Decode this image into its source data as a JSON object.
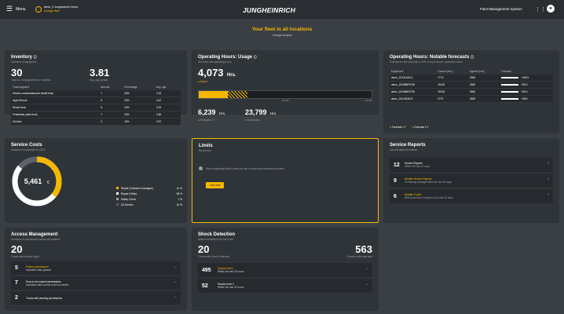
{
  "topbar": {
    "menu_label": "Menu",
    "location_name": "demo_3 Jungheinrich Demo",
    "location_sub": "Change fleet",
    "brand": "JUNGHEINRICH",
    "system_name": "Fleet Management System"
  },
  "hero": {
    "title": "Your fleet in all locations",
    "subtitle": "Change location"
  },
  "inventory": {
    "title": "Inventory",
    "subtitle": "Overview of equipment",
    "count": "30",
    "count_label": "Total no. of equipment in 1 locations",
    "avg_age": "3.81",
    "avg_age_label": "Avg. age (years)",
    "columns": [
      "Truck segment",
      "Amount",
      "Percentage",
      "Avg. age"
    ],
    "rows": [
      [
        "Electric counterbalanced forklift truck",
        "7",
        "23%",
        "3.25"
      ],
      [
        "High lift truck",
        "6",
        "20%",
        "4.42"
      ],
      [
        "Reach truck",
        "6",
        "20%",
        "3.25"
      ],
      [
        "Pedestrian pallet truck",
        "7",
        "23%",
        "3.86"
      ],
      [
        "All other",
        "3",
        "10%",
        "3.97"
      ]
    ]
  },
  "operating_usage": {
    "title": "Operating Hours: Usage",
    "subtitle": "All trucks with operating hours",
    "total": "4,073",
    "unit": "Hrs.",
    "total_label": "● Actual",
    "progress": 0.28,
    "axis_mid": "16,000",
    "axis_end": "32,000",
    "forecast_value": "6,239",
    "forecast_unit": "Hrs.",
    "forecast_label": "Forecast 1 Y",
    "contract_value": "23,799",
    "contract_unit": "Hrs.",
    "contract_label": "Contracted"
  },
  "notable_forecasts": {
    "title": "Operating Hours: Notable forecasts",
    "subtitle": "Forecast for the next year is 10% or more above contracted hours",
    "columns": [
      "Equipment",
      "Current (Hrs.)",
      "Agreed (Hrs.)",
      "Forecast"
    ],
    "rows": [
      [
        "demo_2013143212",
        "7773",
        "3500",
        "+181%"
      ],
      [
        "demo_2016BBF0790",
        "29130",
        "3800",
        "+91%"
      ],
      [
        "demo_2016BBF0790",
        "29130",
        "3800",
        "+91%"
      ],
      [
        "demo_2101943675",
        "4737",
        "3500",
        "+48%"
      ]
    ],
    "legend": [
      "Forecast 1 Y",
      "Forecast 2 Y"
    ]
  },
  "service_costs": {
    "title": "Service Costs",
    "subtitle": "Analysis of equipment for 2022",
    "total": "5,461",
    "currency": "€",
    "legend": [
      {
        "label": "Repair (Customer Damages)",
        "value": "41 %",
        "color": "#f5b800"
      },
      {
        "label": "Repair (Other)",
        "value": "58 %",
        "color": "#ffffff"
      },
      {
        "label": "Safety Check",
        "value": "1 %",
        "color": "#9aa0a6"
      },
      {
        "label": "Oil Service",
        "value": "16 %",
        "color": "#5c6268"
      }
    ]
  },
  "limits": {
    "title": "Limits",
    "subtitle": "No limit set",
    "message": "Start configuring limits to keep an eye on your most important numbers",
    "button": "Add limit"
  },
  "service_reports": {
    "title": "Service Reports",
    "subtitle": "List and stats information",
    "items": [
      {
        "num": "12",
        "title": "Service Reports",
        "desc": "Within the last 14 days",
        "highlight": false
      },
      {
        "num": "9",
        "title": "Notable Service Reports",
        "desc": "Containing damage within the last 30 days",
        "highlight": true
      },
      {
        "num": "6",
        "title": "Notable Trucks",
        "desc": "With more than 3 repairs in the last 90 days",
        "highlight": true
      }
    ]
  },
  "access_management": {
    "title": "Access Management",
    "subtitle": "Overview of permissions across all locations",
    "count": "20",
    "count_label": "Trucks with Access Mgmt",
    "items": [
      {
        "num": "5",
        "title": "Expired permissions",
        "desc": "expiration date passed",
        "highlight": true
      },
      {
        "num": "7",
        "title": "Soon to be expired permissions",
        "desc": "expiration date sooner than two weeks",
        "highlight": false
      },
      {
        "num": "2",
        "title": "Trucks with pending permissions",
        "desc": "",
        "highlight": false
      }
    ]
  },
  "shock_detection": {
    "title": "Shock Detection",
    "subtitle": "Select a timeframe for the event",
    "count": "20",
    "count_label": "Trucks with Shock Detection",
    "total": "563",
    "total_label": "Shocks in the last year",
    "items": [
      {
        "num": "495",
        "title": "Shocks level 1",
        "desc": "Within the last 24 hours",
        "highlight": true
      },
      {
        "num": "52",
        "title": "Shocks level 2",
        "desc": "Within the last 24 hours",
        "highlight": false
      }
    ]
  }
}
